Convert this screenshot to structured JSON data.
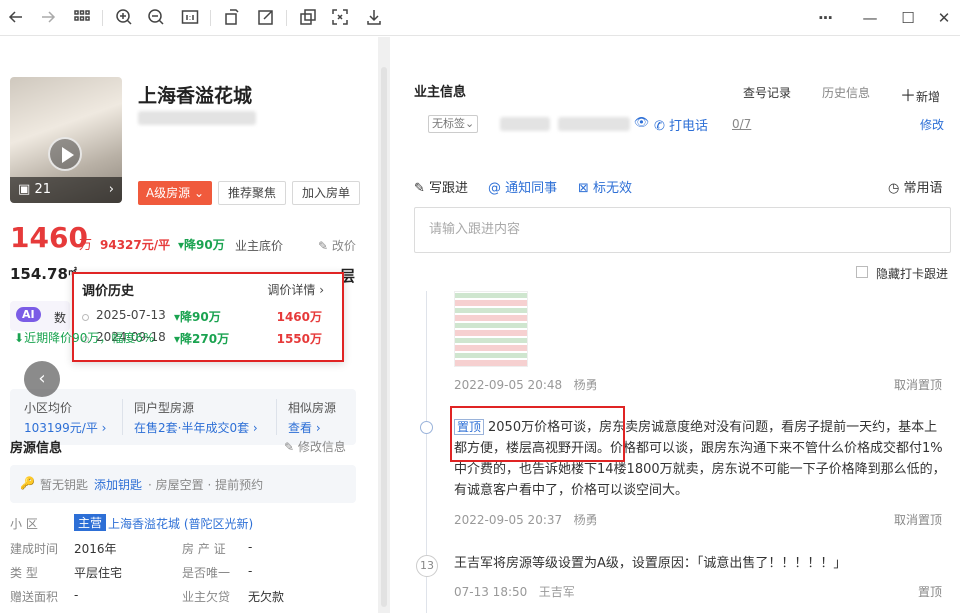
{
  "toolbar": {
    "icons": [
      "back-icon",
      "forward-icon",
      "grid-icon",
      "zoom-in-icon",
      "zoom-out-icon",
      "actual-size-icon",
      "rotate-icon",
      "edit-icon",
      "copy-icon",
      "fullscreen-icon",
      "download-icon"
    ],
    "more": "···",
    "minimize": "—",
    "maximize": "☐",
    "close": "✕"
  },
  "listing": {
    "title": "上海香溢花城",
    "photo_count": "21",
    "grade_tag": "A级房源",
    "btn_recommend": "推荐聚焦",
    "btn_add_list": "加入房单",
    "price": "1460",
    "price_unit": "万",
    "unit_price": "94327元/平",
    "drop": "降90万",
    "owner_floor": "业主底价",
    "change_price": "改价",
    "area": "154.78",
    "area_suffix": "㎡",
    "floor_suffix": "层",
    "ai_label": "AI",
    "ai_text": "数",
    "recent_drop": "近期降价90万，幅度6%"
  },
  "price_history": {
    "title": "调价历史",
    "detail": "调价详情",
    "rows": [
      {
        "date": "2025-07-13",
        "drop": "降90万",
        "price": "1460万"
      },
      {
        "date": "2024-09-18",
        "drop": "降270万",
        "price": "1550万"
      }
    ]
  },
  "stats": {
    "c1_label": "小区均价",
    "c1_value": "103199元/平",
    "c2_label": "同户型房源",
    "c2_value": "在售2套·半年成交0套",
    "c3_label": "相似房源",
    "c3_value": "查看"
  },
  "house_info": {
    "title": "房源信息",
    "edit": "修改信息",
    "key_text": "暂无钥匙",
    "key_link": "添加钥匙",
    "key_extra": "· 房屋空置 · 提前预约",
    "rows": [
      {
        "k": "小    区",
        "tag": "主营",
        "v": "上海香溢花城 (普陀区光新)"
      },
      {
        "k": "建成时间",
        "v": "2016年",
        "k2": "房 产 证",
        "v2": "-"
      },
      {
        "k": "类    型",
        "v": "平层住宅",
        "k2": "是否唯一",
        "v2": "-"
      },
      {
        "k": "赠送面积",
        "v": "-",
        "k2": "业主欠贷",
        "v2": "无欠款"
      }
    ]
  },
  "owner": {
    "title": "业主信息",
    "query_record": "查号记录",
    "history": "历史信息",
    "add": "新增",
    "tag_select": "无标签",
    "call": "打电话",
    "call_count": "0/7",
    "modify": "修改"
  },
  "follow": {
    "write": "写跟进",
    "notify": "通知同事",
    "mark_invalid": "标无效",
    "common_phrases": "常用语",
    "placeholder": "请输入跟进内容",
    "hide_checkin": "隐藏打卡跟进"
  },
  "timeline": [
    {
      "time": "2022-09-05 20:48",
      "user": "杨勇",
      "action": "取消置顶"
    },
    {
      "pin": "置顶",
      "text": "2050万价格可谈，房东卖房诚意度绝对没有问题，看房子提前一天约，基本上都方便，楼层高视野开阔。价格都可以谈，跟房东沟通下来不管什么价格成交都付1%中介费的，也告诉她楼下14楼1800万就卖，房东说不可能一下子价格降到那么低的，有诚意客户看中了，价格可以谈空间大。",
      "time": "2022-09-05 20:37",
      "user": "杨勇",
      "action": "取消置顶"
    },
    {
      "num": "13",
      "text": "王吉军将房源等级设置为A级，设置原因：「诚意出售了！！！！！」",
      "time": "07-13 18:50",
      "user": "王吉军",
      "action": "置顶"
    }
  ]
}
